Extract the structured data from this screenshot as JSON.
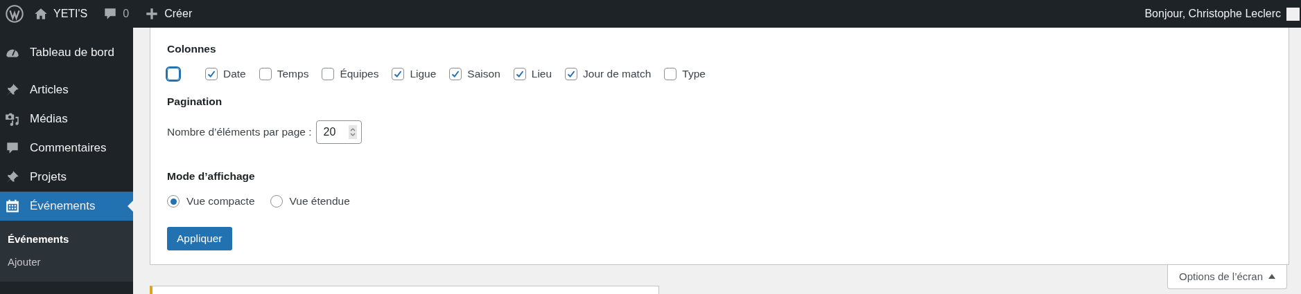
{
  "admin_bar": {
    "site_name": "YETI'S",
    "comments_count": "0",
    "new_label": "Créer",
    "greeting": "Bonjour, Christophe Leclerc"
  },
  "sidebar": {
    "items": [
      {
        "label": "Tableau de bord",
        "selected": false
      },
      {
        "label": "Articles",
        "selected": false
      },
      {
        "label": "Médias",
        "selected": false
      },
      {
        "label": "Commentaires",
        "selected": false
      },
      {
        "label": "Projets",
        "selected": false
      },
      {
        "label": "Événements",
        "selected": true,
        "children": [
          {
            "label": "Événements",
            "selected": true
          },
          {
            "label": "Ajouter",
            "selected": false
          }
        ]
      }
    ]
  },
  "screen_options": {
    "columns": {
      "title": "Colonnes",
      "items": [
        {
          "checked": false,
          "focused": true
        },
        {
          "label": "Date",
          "checked": true,
          "focused": false
        },
        {
          "label": "Temps",
          "checked": false,
          "focused": false
        },
        {
          "label": "Équipes",
          "checked": false,
          "focused": false
        },
        {
          "label": "Ligue",
          "checked": true,
          "focused": false
        },
        {
          "label": "Saison",
          "checked": true,
          "focused": false
        },
        {
          "label": "Lieu",
          "checked": true,
          "focused": false
        },
        {
          "label": "Jour de match",
          "checked": true,
          "focused": false
        },
        {
          "label": "Type",
          "checked": false,
          "focused": false
        }
      ]
    },
    "pagination": {
      "title": "Pagination",
      "label": "Nombre d’éléments par page :",
      "value": "20"
    },
    "view_mode": {
      "title": "Mode d’affichage",
      "options": [
        {
          "label": "Vue compacte",
          "selected": true
        },
        {
          "label": "Vue étendue",
          "selected": false
        }
      ]
    },
    "apply_button": "Appliquer",
    "toggle_label": "Options de l’écran"
  }
}
